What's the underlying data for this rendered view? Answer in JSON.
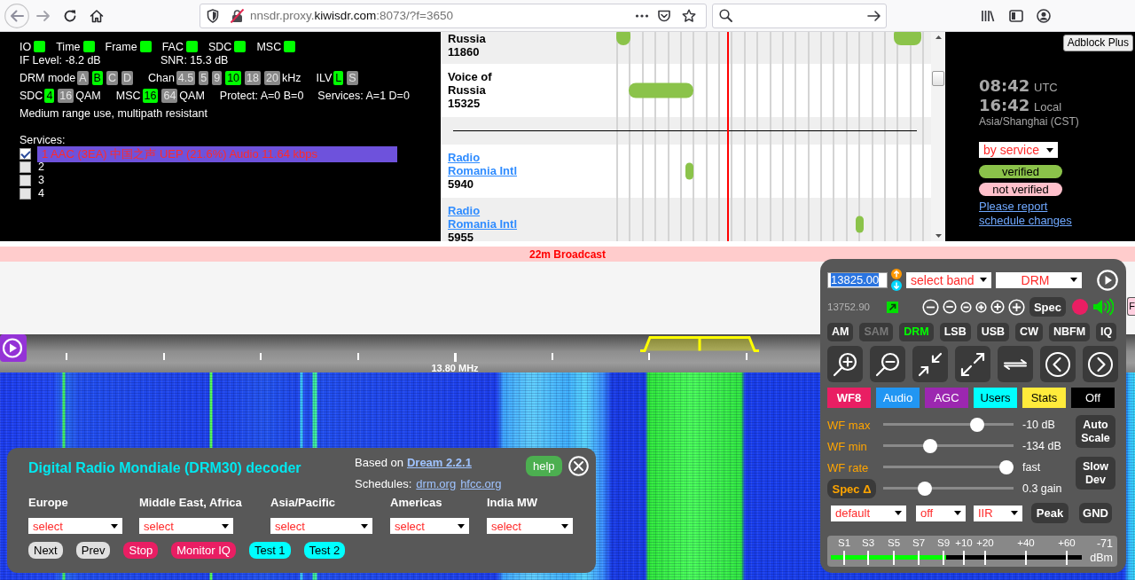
{
  "browser": {
    "url": {
      "prefix": "nnsdr.proxy.",
      "domain": "kiwisdr.com",
      "suffix": ":8073/?f=3650"
    }
  },
  "drm_status": {
    "indicators": [
      {
        "label": "IO",
        "color": "#00ff00"
      },
      {
        "label": "Time",
        "color": "#00ff00"
      },
      {
        "label": "Frame",
        "color": "#00ff00"
      },
      {
        "label": "FAC",
        "color": "#00ff00"
      },
      {
        "label": "SDC",
        "color": "#00ff00"
      },
      {
        "label": "MSC",
        "color": "#00ff00"
      }
    ],
    "if_level": "IF Level: -8.2 dB",
    "snr": "SNR: 15.3 dB",
    "mode_groups": [
      {
        "label": "DRM mode",
        "options": [
          {
            "label": "A",
            "selected": false
          },
          {
            "label": "B",
            "selected": true
          },
          {
            "label": "C",
            "selected": false
          },
          {
            "label": "D",
            "selected": false
          }
        ]
      },
      {
        "label": "Chan",
        "options": [
          {
            "label": "4.5",
            "selected": false
          },
          {
            "label": "5",
            "selected": false
          },
          {
            "label": "9",
            "selected": false
          },
          {
            "label": "10",
            "selected": true
          },
          {
            "label": "18",
            "selected": false
          },
          {
            "label": "20",
            "selected": false
          }
        ],
        "unit": "kHz"
      },
      {
        "label": "ILV",
        "options": [
          {
            "label": "L",
            "selected": true
          },
          {
            "label": "S",
            "selected": false
          }
        ]
      }
    ],
    "qam_groups": [
      {
        "label": "SDC",
        "options": [
          {
            "label": "4",
            "selected": true
          },
          {
            "label": "16",
            "selected": false
          }
        ],
        "unit": "QAM"
      },
      {
        "label": "MSC",
        "options": [
          {
            "label": "16",
            "selected": true
          },
          {
            "label": "64",
            "selected": false
          }
        ],
        "unit": "QAM"
      }
    ],
    "protect": "Protect: A=0 B=0",
    "service_counts": "Services: A=1 D=0",
    "description": "Medium range use, multipath resistant",
    "services_label": "Services:",
    "services": [
      {
        "label": "1 AAC (3EA) 中国之声 UEP (21.6%) Audio 11.64 kbps",
        "checked": true,
        "selected": true
      },
      {
        "label": "2",
        "checked": false,
        "selected": false
      },
      {
        "label": "3",
        "checked": false,
        "selected": false
      },
      {
        "label": "4",
        "checked": false,
        "selected": false
      }
    ]
  },
  "schedule": {
    "rows": [
      {
        "kind": "station",
        "name": "Russia",
        "link": false,
        "frequency": "11860",
        "verified": true
      },
      {
        "kind": "station",
        "name": "Voice of Russia",
        "link": false,
        "frequency": "15325",
        "verified": true
      },
      {
        "kind": "divider"
      },
      {
        "kind": "station",
        "name": "Radio Romania Intl",
        "link": true,
        "frequency": "5940",
        "verified": true
      },
      {
        "kind": "station",
        "name": "Radio Romania Intl",
        "link": true,
        "frequency": "5955",
        "verified": true
      }
    ]
  },
  "schedule_info": {
    "adblock_button": "Adblock Plus",
    "times": [
      {
        "time": "08:42",
        "zone": "UTC"
      },
      {
        "time": "16:42",
        "zone": "Local"
      }
    ],
    "timezone": "Asia/Shanghai (CST)",
    "sort_select": "by service",
    "legend": [
      {
        "label": "verified",
        "color": "#8bc34a"
      },
      {
        "label": "not verified",
        "color": "#ffc0cb"
      }
    ],
    "report_link": "Please report schedule changes"
  },
  "band_bar": {
    "label": "22m Broadcast"
  },
  "scale": {
    "label": "13.80 MHz"
  },
  "decoder": {
    "title": "Digital Radio Mondiale (DRM30) decoder",
    "based_on": {
      "label": "Based on",
      "link": "Dream 2.2.1"
    },
    "schedules": {
      "label": "Schedules:",
      "links": [
        "drm.org",
        "hfcc.org"
      ]
    },
    "help": "help",
    "regions": [
      {
        "label": "Europe",
        "value": "select"
      },
      {
        "label": "Middle East, Africa",
        "value": "select"
      },
      {
        "label": "Asia/Pacific",
        "value": "select"
      },
      {
        "label": "Americas",
        "value": "select"
      },
      {
        "label": "India MW",
        "value": "select"
      }
    ],
    "buttons": [
      {
        "label": "Next",
        "color": "#e0e0e0"
      },
      {
        "label": "Prev",
        "color": "#e0e0e0"
      },
      {
        "label": "Stop",
        "color": "#e91e63"
      },
      {
        "label": "Monitor IQ",
        "color": "#e91e63"
      },
      {
        "label": "Test 1",
        "color": "#00ffff"
      },
      {
        "label": "Test 2",
        "color": "#00ffff"
      }
    ]
  },
  "controls": {
    "frequency": {
      "value": "13825.00",
      "text_selected": true
    },
    "band_select": "select band",
    "mode_select": "DRM",
    "passband_freq": "13752.90",
    "spec_button": "Spec",
    "modes": [
      {
        "label": "AM",
        "selected": false,
        "disabled": false
      },
      {
        "label": "SAM",
        "selected": false,
        "disabled": true
      },
      {
        "label": "DRM",
        "selected": true,
        "disabled": false
      },
      {
        "label": "LSB",
        "selected": false,
        "disabled": false
      },
      {
        "label": "USB",
        "selected": false,
        "disabled": false
      },
      {
        "label": "CW",
        "selected": false,
        "disabled": false
      },
      {
        "label": "NBFM",
        "selected": false,
        "disabled": false
      },
      {
        "label": "IQ",
        "selected": false,
        "disabled": false
      }
    ],
    "tabs": [
      {
        "label": "WF8",
        "color": "#e91e63",
        "selected": true
      },
      {
        "label": "Audio",
        "color": "#2196f3",
        "selected": false
      },
      {
        "label": "AGC",
        "color": "#9c27b0",
        "selected": false
      },
      {
        "label": "Users",
        "color": "#00ffff",
        "selected": false
      },
      {
        "label": "Stats",
        "color": "#ffeb3b",
        "selected": false
      },
      {
        "label": "Off",
        "color": "#000000",
        "selected": false
      }
    ],
    "sliders": [
      {
        "kind": "label",
        "label": "WF max",
        "level": 0.75,
        "value": "-10 dB"
      },
      {
        "kind": "label",
        "label": "WF min",
        "level": 0.34,
        "value": "-134 dB"
      },
      {
        "kind": "label",
        "label": "WF rate",
        "level": 1.0,
        "value": "fast"
      },
      {
        "kind": "button",
        "label": "Spec Δ",
        "level": 0.3,
        "value": "0.3 gain"
      }
    ],
    "side_buttons": [
      "Auto Scale",
      "Slow Dev"
    ],
    "selects": [
      "default",
      "off",
      "IIR"
    ],
    "buttons": [
      "Peak",
      "GND"
    ],
    "s_meter": {
      "scale": [
        "S1",
        "S3",
        "S5",
        "S7",
        "S9",
        "+10",
        "+20",
        "+40",
        "+60"
      ],
      "level": 0.46,
      "reading": "-71",
      "unit": "dBm"
    }
  },
  "edge_button": "F"
}
